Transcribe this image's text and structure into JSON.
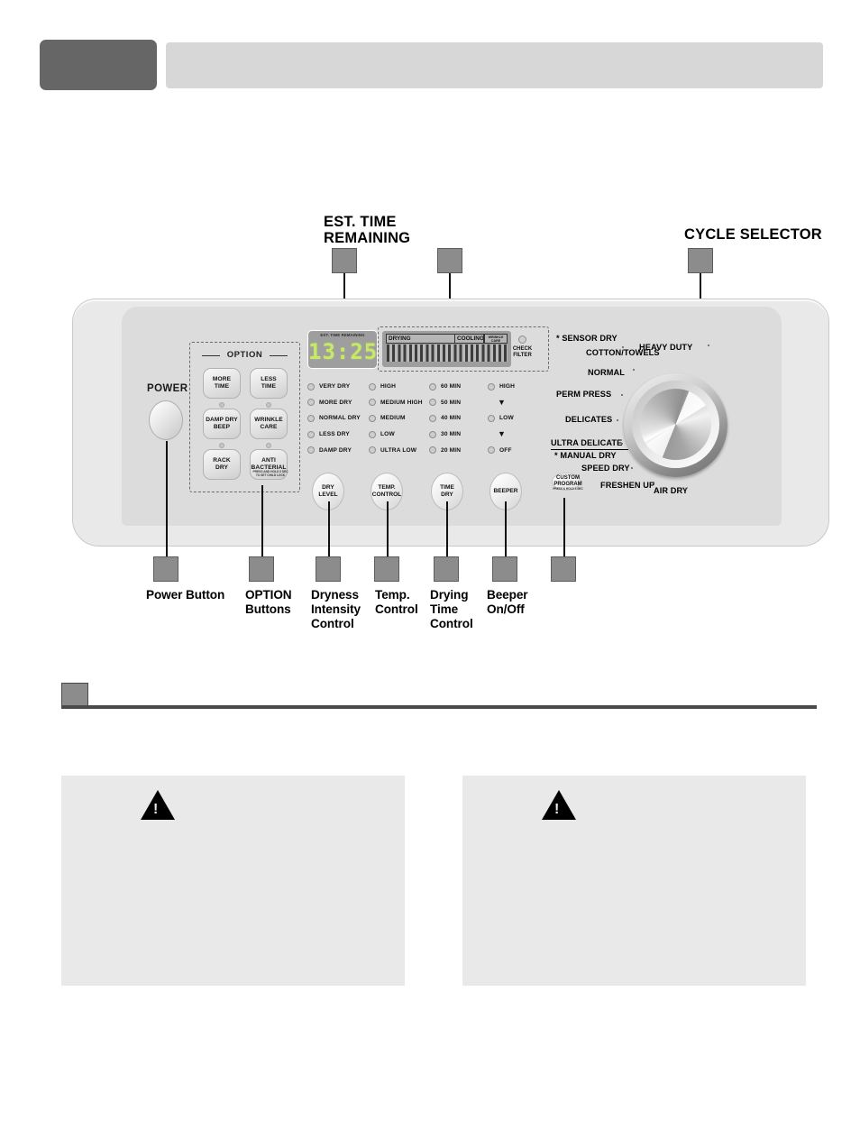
{
  "header": {
    "tab_label": "",
    "bar_label": ""
  },
  "callouts_top": {
    "est_time": "EST. TIME\nREMAINING",
    "cycle_selector": "CYCLE SELECTOR"
  },
  "panel": {
    "power": {
      "label": "POWER"
    },
    "option_group": {
      "caption": "OPTION",
      "buttons": [
        {
          "label": "MORE\nTIME",
          "has_led": false
        },
        {
          "label": "LESS\nTIME",
          "has_led": false
        },
        {
          "label": "DAMP DRY\nBEEP",
          "has_led": true
        },
        {
          "label": "WRINKLE\nCARE",
          "has_led": true
        },
        {
          "label": "RACK\nDRY",
          "has_led": true
        },
        {
          "label": "ANTI\nBACTERIAL",
          "has_led": true
        }
      ],
      "child_lock_note": "PRESS AND HOLD 3 SEC\nTO SET CHILD LOCK"
    },
    "display": {
      "caption": "EST. TIME REMAINING",
      "time_value": "13:25"
    },
    "status_bar": {
      "drying": "DRYING",
      "cooling": "COOLING",
      "wrinkle_care": "WRINKLE\nCARE",
      "check_filter": "CHECK\nFILTER"
    },
    "indicator_columns": [
      {
        "name": "dryness",
        "items": [
          {
            "label": "VERY DRY",
            "type": "led"
          },
          {
            "label": "MORE DRY",
            "type": "led"
          },
          {
            "label": "NORMAL DRY",
            "type": "led"
          },
          {
            "label": "LESS DRY",
            "type": "led"
          },
          {
            "label": "DAMP DRY",
            "type": "led"
          }
        ]
      },
      {
        "name": "temperature",
        "items": [
          {
            "label": "HIGH",
            "type": "led"
          },
          {
            "label": "MEDIUM HIGH",
            "type": "led"
          },
          {
            "label": "MEDIUM",
            "type": "led"
          },
          {
            "label": "LOW",
            "type": "led"
          },
          {
            "label": "ULTRA LOW",
            "type": "led"
          }
        ]
      },
      {
        "name": "time",
        "items": [
          {
            "label": "60 MIN",
            "type": "led"
          },
          {
            "label": "50 MIN",
            "type": "led"
          },
          {
            "label": "40 MIN",
            "type": "led"
          },
          {
            "label": "30 MIN",
            "type": "led"
          },
          {
            "label": "20 MIN",
            "type": "led"
          }
        ]
      },
      {
        "name": "beeper",
        "items": [
          {
            "label": "HIGH",
            "type": "led"
          },
          {
            "label": "▼",
            "type": "arrow"
          },
          {
            "label": "LOW",
            "type": "led"
          },
          {
            "label": "▼",
            "type": "arrow"
          },
          {
            "label": "OFF",
            "type": "led"
          }
        ]
      }
    ],
    "control_buttons": [
      {
        "label": "DRY\nLEVEL"
      },
      {
        "label": "TEMP.\nCONTROL"
      },
      {
        "label": "TIME\nDRY"
      },
      {
        "label": "BEEPER"
      }
    ],
    "custom_program": {
      "label": "CUSTOM\nPROGRAM",
      "note": "PRESS & HOLD 3 SEC"
    },
    "cycle_labels": [
      "* SENSOR DRY",
      "COTTON/TOWELS",
      "NORMAL",
      "PERM PRESS",
      "DELICATES",
      "ULTRA DELICATE",
      "* MANUAL DRY",
      "SPEED DRY",
      "FRESHEN UP",
      "AIR DRY",
      "HEAVY DUTY"
    ]
  },
  "callouts_bottom": [
    "Power Button",
    "OPTION\nButtons",
    "Dryness\nIntensity\nControl",
    "Temp.\nControl",
    "Drying\nTime\nControl",
    "Beeper\nOn/Off",
    ""
  ],
  "warnings": [
    {
      "icon": "warning-triangle-icon",
      "text": ""
    },
    {
      "icon": "warning-triangle-icon",
      "text": ""
    }
  ],
  "colors": {
    "panel_bg": "#e9e9e9",
    "panel_inner": "#dcdcdc",
    "led_green": "#c8e86a",
    "callout_box": "#8c8c8c",
    "header_dark": "#666666",
    "header_light": "#d7d7d7"
  }
}
